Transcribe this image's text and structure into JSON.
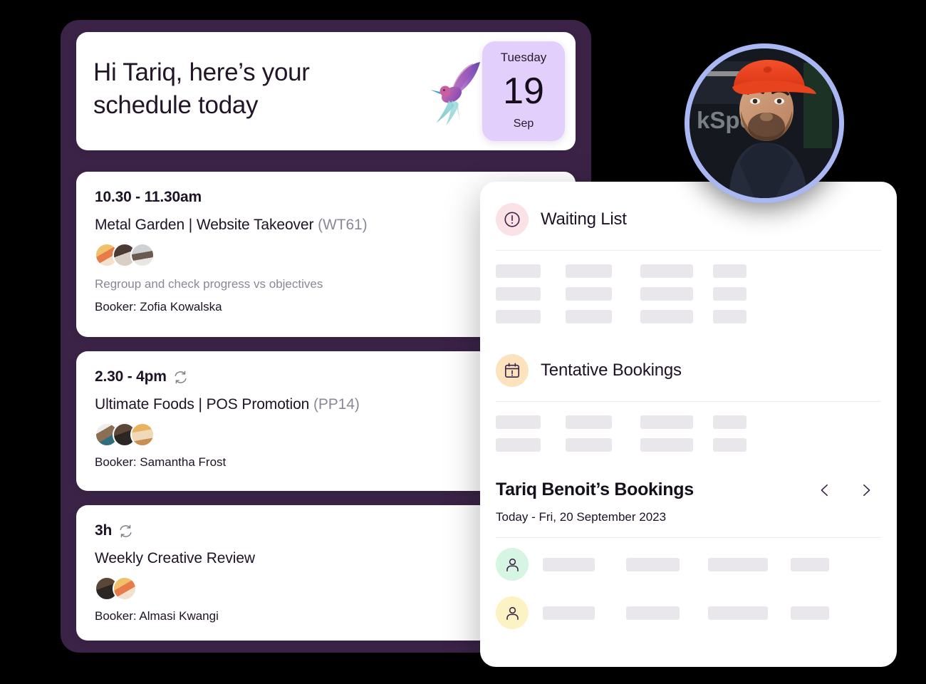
{
  "greeting": {
    "title": "Hi Tariq, here’s your schedule today",
    "bird_icon": "hummingbird-icon",
    "date": {
      "weekday": "Tuesday",
      "day": "19",
      "month": "Sep"
    }
  },
  "bookings": [
    {
      "time": "10.30 - 11.30am",
      "recurring": false,
      "title": "Metal Garden | Website Takeover ",
      "ref": "(WT61)",
      "attendee_count": 3,
      "description": "Regroup and check progress vs objectives",
      "booker": "Booker: Zofia Kowalska"
    },
    {
      "time": "2.30 - 4pm",
      "recurring": true,
      "title": "Ultimate Foods | POS Promotion ",
      "ref": "(PP14)",
      "attendee_count": 3,
      "description": "",
      "booker": "Booker: Samantha Frost"
    },
    {
      "time": "3h",
      "recurring": true,
      "title": "Weekly Creative Review",
      "ref": "",
      "attendee_count": 2,
      "description": "",
      "booker": "Booker: Almasi Kwangi"
    }
  ],
  "panel": {
    "waiting_list": {
      "label": "Waiting List",
      "icon": "alert-circle-icon",
      "icon_bg": "#FBE2E6",
      "icon_color": "#3B2347",
      "skeleton_rows": 3,
      "skeleton_widths": [
        63,
        65,
        74,
        47
      ]
    },
    "tentative": {
      "label": "Tentative Bookings",
      "icon": "calendar-alert-icon",
      "icon_bg": "#FCE3BE",
      "icon_color": "#3B2347",
      "skeleton_rows": 2,
      "skeleton_widths": [
        63,
        65,
        74,
        47
      ]
    },
    "bookings_section": {
      "title": "Tariq Benoit’s Bookings",
      "subtitle": "Today - Fri, 20 September 2023",
      "prev_icon": "chevron-left-icon",
      "next_icon": "chevron-right-icon",
      "rows": [
        {
          "avatar_icon": "user-icon",
          "avatar_bg": "#D6F5E3",
          "skeleton_widths": [
            63,
            65,
            74,
            47
          ]
        },
        {
          "avatar_icon": "user-icon",
          "avatar_bg": "#FBF3C4",
          "skeleton_widths": [
            63,
            65,
            74,
            47
          ]
        }
      ]
    }
  },
  "profile": {
    "icon": "user-photo",
    "ring_color": "#A9B7F2"
  },
  "colors": {
    "shell": "#3B2347",
    "date_badge": "#E3CFFB",
    "skeleton": "#E9E7EC"
  }
}
